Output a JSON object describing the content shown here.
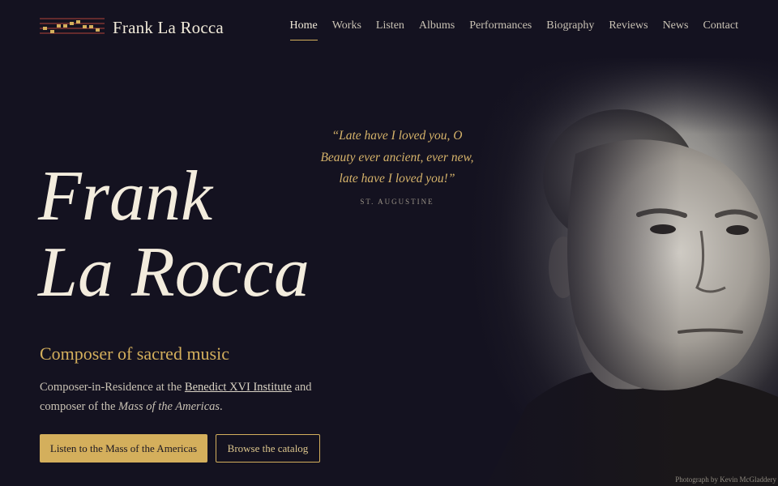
{
  "header": {
    "brand": "Frank La Rocca",
    "logo_icon": "music-staff-icon",
    "nav": [
      {
        "label": "Home",
        "active": true
      },
      {
        "label": "Works",
        "active": false
      },
      {
        "label": "Listen",
        "active": false
      },
      {
        "label": "Albums",
        "active": false
      },
      {
        "label": "Performances",
        "active": false
      },
      {
        "label": "Biography",
        "active": false
      },
      {
        "label": "Reviews",
        "active": false
      },
      {
        "label": "News",
        "active": false
      },
      {
        "label": "Contact",
        "active": false
      }
    ]
  },
  "quote": {
    "line1": "“Late have I loved you, O",
    "line2": "Beauty ever ancient, ever new,",
    "line3": "late have I loved you!”",
    "attribution": "ST. AUGUSTINE"
  },
  "hero": {
    "title_line1": "Frank",
    "title_line2": "La Rocca",
    "subtitle": "Composer of sacred music",
    "desc_prefix": "Composer-in-Residence at the ",
    "desc_link": "Benedict XVI Institute",
    "desc_middle": " and composer of the ",
    "desc_italic": "Mass of the Americas",
    "desc_suffix": ".",
    "primary_button": "Listen to the Mass of the Americas",
    "secondary_button": "Browse the catalog"
  },
  "photo_credit": "Photograph by Kevin McGladdery",
  "colors": {
    "background": "#141220",
    "accent": "#d4af5c",
    "text": "#ece4d4"
  }
}
